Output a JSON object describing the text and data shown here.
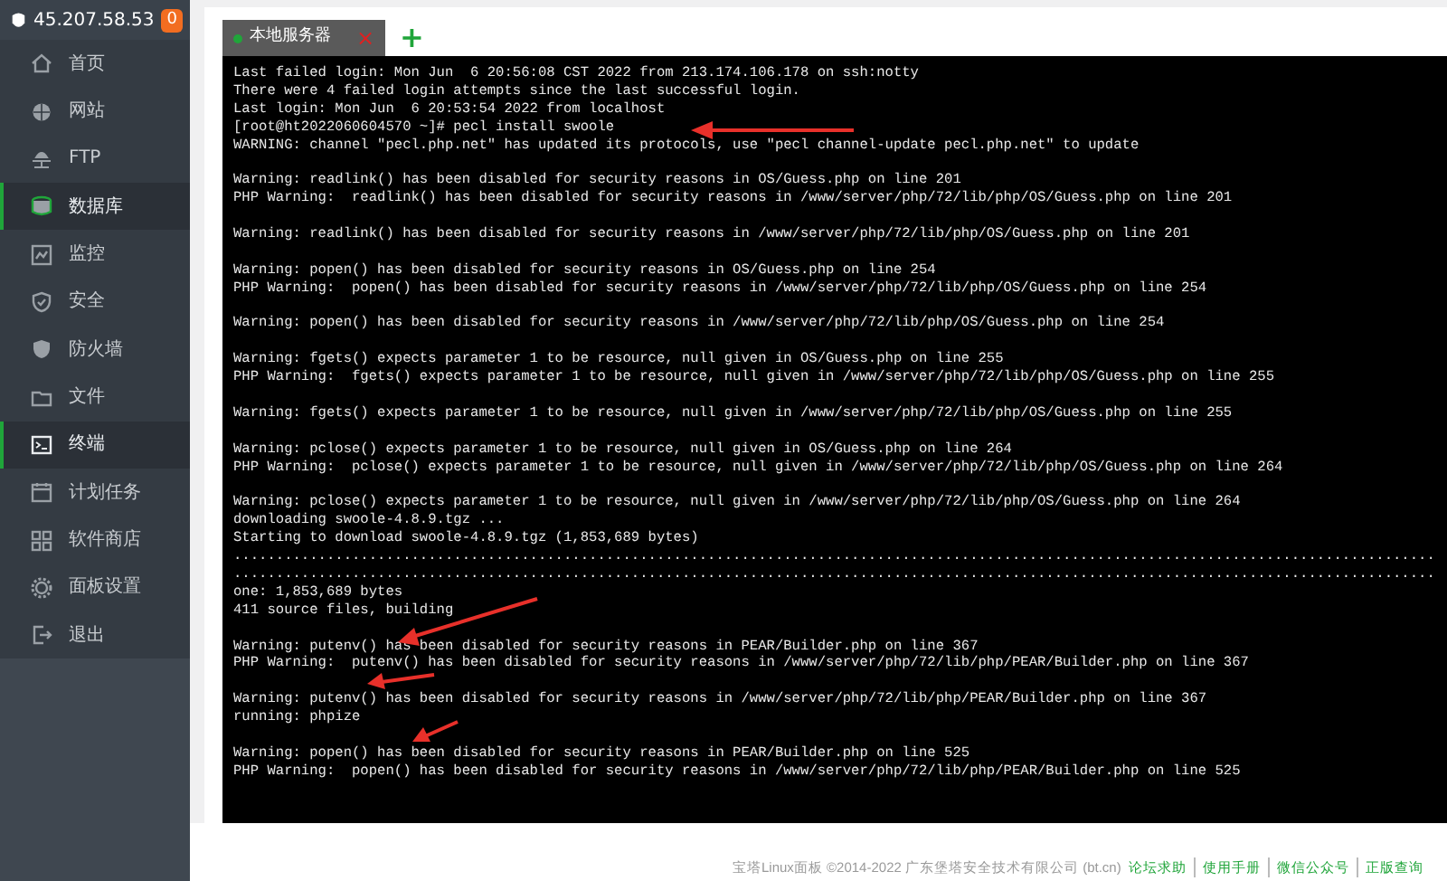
{
  "sidebar": {
    "server_ip": "45.207.58.53",
    "badge": "0",
    "items": [
      {
        "label": "首页",
        "selected": false
      },
      {
        "label": "网站",
        "selected": false
      },
      {
        "label": "FTP",
        "selected": false
      },
      {
        "label": "数据库",
        "selected": true
      },
      {
        "label": "监控",
        "selected": false
      },
      {
        "label": "安全",
        "selected": false
      },
      {
        "label": "防火墙",
        "selected": false
      },
      {
        "label": "文件",
        "selected": false
      },
      {
        "label": "终端",
        "selected": true
      },
      {
        "label": "计划任务",
        "selected": false
      },
      {
        "label": "软件商店",
        "selected": false
      },
      {
        "label": "面板设置",
        "selected": false
      },
      {
        "label": "退出",
        "selected": false
      }
    ]
  },
  "tabs": [
    {
      "label": "本地服务器",
      "selected": true,
      "close": "×"
    }
  ],
  "add_tab": "+",
  "terminal": {
    "blocks": [
      [
        "Last failed login: Mon Jun  6 20:56:08 CST 2022 from 213.174.106.178 on ssh:notty",
        "There were 4 failed login attempts since the last successful login.",
        "Last login: Mon Jun  6 20:53:54 2022 from localhost",
        "[root@ht2022060604570 ~]# pecl install swoole",
        "WARNING: channel \"pecl.php.net\" has updated its protocols, use \"pecl channel-update pecl.php.net\" to update"
      ],
      [
        "Warning: readlink() has been disabled for security reasons in OS/Guess.php on line 201",
        "PHP Warning:  readlink() has been disabled for security reasons in /www/server/php/72/lib/php/OS/Guess.php on line 201"
      ],
      [
        "Warning: readlink() has been disabled for security reasons in /www/server/php/72/lib/php/OS/Guess.php on line 201"
      ],
      [
        "Warning: popen() has been disabled for security reasons in OS/Guess.php on line 254",
        "PHP Warning:  popen() has been disabled for security reasons in /www/server/php/72/lib/php/OS/Guess.php on line 254"
      ],
      [
        "Warning: popen() has been disabled for security reasons in /www/server/php/72/lib/php/OS/Guess.php on line 254"
      ],
      [
        "Warning: fgets() expects parameter 1 to be resource, null given in OS/Guess.php on line 255",
        "PHP Warning:  fgets() expects parameter 1 to be resource, null given in /www/server/php/72/lib/php/OS/Guess.php on line 255"
      ],
      [
        "Warning: fgets() expects parameter 1 to be resource, null given in /www/server/php/72/lib/php/OS/Guess.php on line 255"
      ],
      [
        "Warning: pclose() expects parameter 1 to be resource, null given in OS/Guess.php on line 264",
        "PHP Warning:  pclose() expects parameter 1 to be resource, null given in /www/server/php/72/lib/php/OS/Guess.php on line 264"
      ],
      [
        "Warning: pclose() expects parameter 1 to be resource, null given in /www/server/php/72/lib/php/OS/Guess.php on line 264",
        "downloading swoole-4.8.9.tgz ...",
        "Starting to download swoole-4.8.9.tgz (1,853,689 bytes)",
        "..............................................................................................................................................",
        "..............................................................................................................................................",
        "one: 1,853,689 bytes",
        "411 source files, building"
      ],
      [
        "Warning: putenv() has been disabled for security reasons in PEAR/Builder.php on line 367",
        "PHP Warning:  putenv() has been disabled for security reasons in /www/server/php/72/lib/php/PEAR/Builder.php on line 367"
      ],
      [
        "Warning: putenv() has been disabled for security reasons in /www/server/php/72/lib/php/PEAR/Builder.php on line 367",
        "running: phpize"
      ],
      [
        "Warning: popen() has been disabled for security reasons in PEAR/Builder.php on line 525",
        "PHP Warning:  popen() has been disabled for security reasons in /www/server/php/72/lib/php/PEAR/Builder.php on line 525"
      ]
    ]
  },
  "footer": {
    "copyright": "宝塔Linux面板 ©2014-2022 广东堡塔安全技术有限公司 (bt.cn)",
    "links": [
      "论坛求助",
      "使用手册",
      "微信公众号",
      "正版查询"
    ]
  }
}
